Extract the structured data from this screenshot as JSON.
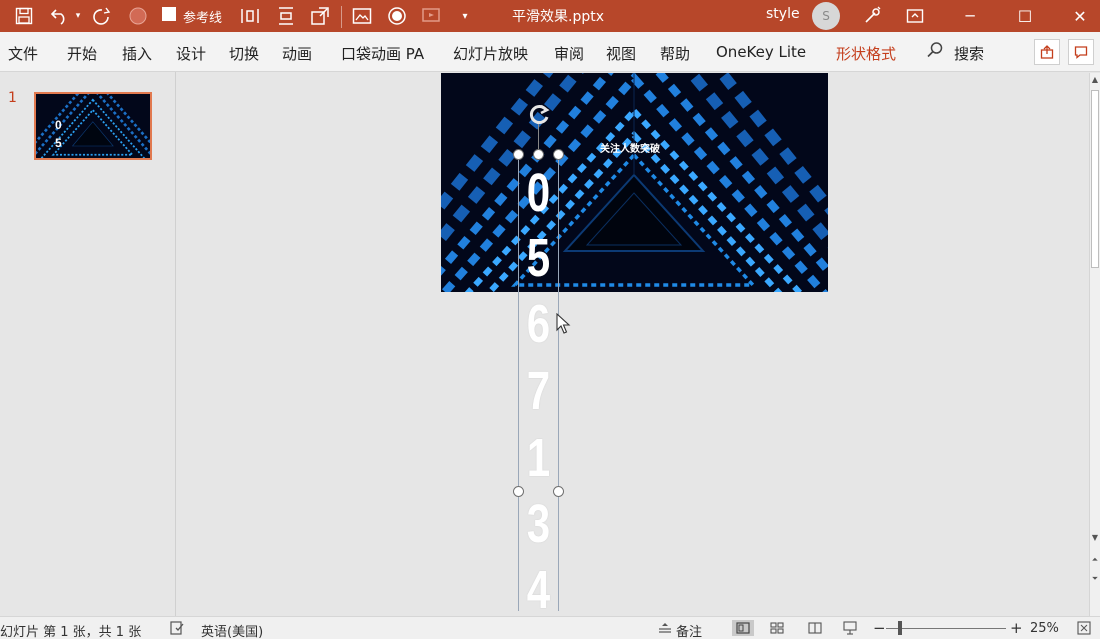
{
  "title_bar": {
    "document_title": "平滑效果.pptx",
    "guides_checkbox_label": "参考线",
    "user_name": "style",
    "avatar_initial": "S",
    "icons": [
      "save-icon",
      "undo-icon",
      "dropdown-icon",
      "redo-icon",
      "record-icon",
      "checkbox",
      "distribute-horizontal-icon",
      "distribute-vertical-icon",
      "select-objects-icon",
      "picture-icon",
      "shape-icon",
      "slide-show-icon",
      "customize-arrow-icon",
      "lightbulb-icon",
      "ribbon-display-icon",
      "minimize-icon",
      "maximize-icon",
      "close-icon"
    ],
    "symbols": {
      "undo_dropdown": "▾",
      "customize": "▾",
      "minimize": "─",
      "maximize": "☐",
      "close": "✕"
    }
  },
  "ribbon": {
    "tabs": [
      {
        "label": "文件"
      },
      {
        "label": "开始"
      },
      {
        "label": "插入"
      },
      {
        "label": "设计"
      },
      {
        "label": "切换"
      },
      {
        "label": "动画"
      },
      {
        "label": "口袋动画 PA"
      },
      {
        "label": "幻灯片放映"
      },
      {
        "label": "审阅"
      },
      {
        "label": "视图"
      },
      {
        "label": "帮助"
      },
      {
        "label": "OneKey Lite"
      },
      {
        "label": "形状格式",
        "active": true
      }
    ],
    "search_label": "搜索",
    "accent_color": "#c43e1c"
  },
  "thumbnails": {
    "slide_number": "1",
    "digits": [
      "0",
      "5"
    ]
  },
  "slide": {
    "title": "关注人数突破",
    "digits_visible": [
      "0",
      "5"
    ],
    "digits_overflow": [
      "6",
      "7",
      "1",
      "3",
      "4"
    ]
  },
  "status_bar": {
    "slide_info": "幻灯片 第 1 张，共 1 张",
    "language": "英语(美国)",
    "notes_label": "备注",
    "zoom_level": "25%",
    "zoom_minus": "−",
    "zoom_plus": "+"
  },
  "colors": {
    "title_bar_bg": "#b7472a",
    "slide_bg": "#02071a",
    "tunnel_glow": "#1e7bd8"
  }
}
